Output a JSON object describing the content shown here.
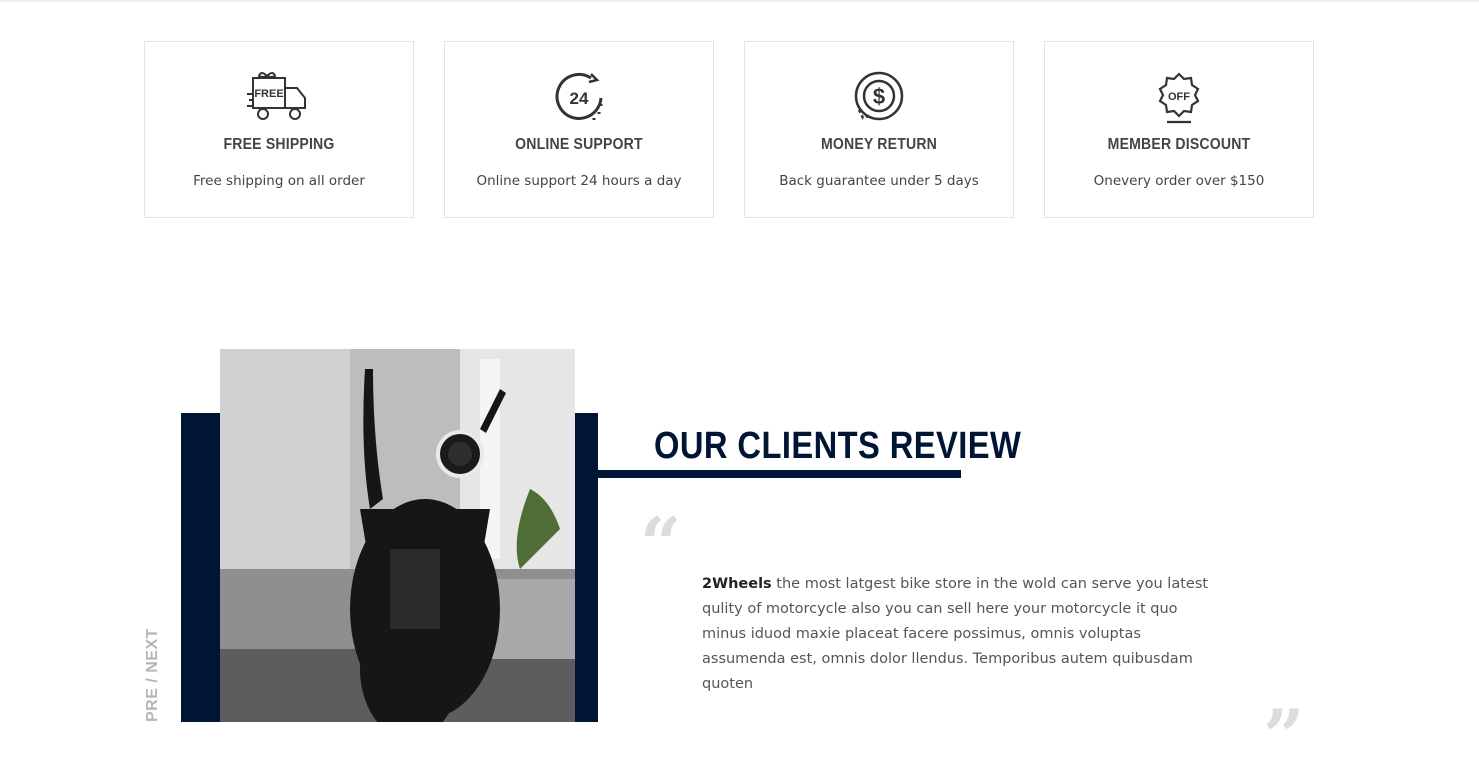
{
  "features": [
    {
      "icon": "free-truck-icon",
      "title": "FREE SHIPPING",
      "desc": "Free shipping on all order",
      "icon_text": "FREE"
    },
    {
      "icon": "support-24-icon",
      "title": "ONLINE SUPPORT",
      "desc": "Online support 24 hours a day",
      "icon_text": "24"
    },
    {
      "icon": "money-return-icon",
      "title": "MONEY RETURN",
      "desc": "Back guarantee under 5 days",
      "icon_text": "$"
    },
    {
      "icon": "discount-badge-icon",
      "title": "MEMBER DISCOUNT",
      "desc": "Onevery order over $150",
      "icon_text": "OFF"
    }
  ],
  "review": {
    "section_title": "OUR CLIENTS REVIEW",
    "side_label": "PRE / NEXT",
    "brand": "2Wheels",
    "text": " the most latgest bike store in the wold can serve you latest qulity of motorcycle also you can sell here your motorcycle it quo minus iduod maxie placeat facere possimus, omnis voluptas assumenda est, omnis dolor llendus. Temporibus autem quibusdam quoten",
    "quote_open": "“",
    "quote_close": "”"
  },
  "colors": {
    "navy": "#001434",
    "border": "#e3e3e3"
  }
}
